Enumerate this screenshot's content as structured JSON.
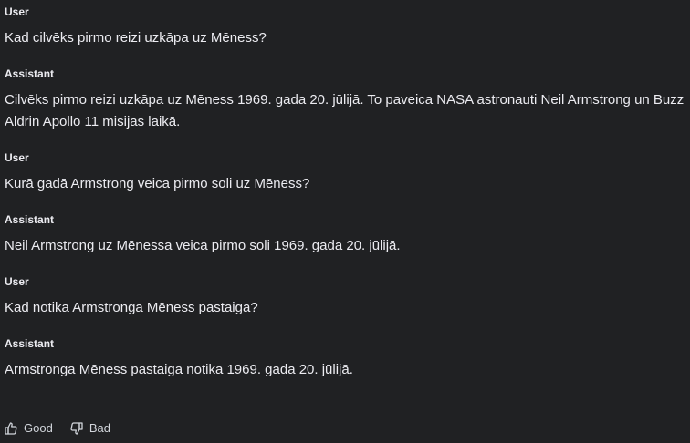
{
  "conversation": [
    {
      "role": "User",
      "text": "Kad cilvēks pirmo reizi uzkāpa uz Mēness?"
    },
    {
      "role": "Assistant",
      "text": "Cilvēks pirmo reizi uzkāpa uz Mēness 1969. gada 20. jūlijā. To paveica NASA astronauti Neil Armstrong un Buzz Aldrin Apollo 11 misijas laikā."
    },
    {
      "role": "User",
      "text": "Kurā gadā Armstrong veica pirmo soli uz Mēness?"
    },
    {
      "role": "Assistant",
      "text": "Neil Armstrong uz Mēnessa veica pirmo soli 1969. gada 20. jūlijā."
    },
    {
      "role": "User",
      "text": "Kad notika Armstronga Mēness pastaiga?"
    },
    {
      "role": "Assistant",
      "text": "Armstronga Mēness pastaiga notika 1969. gada 20. jūlijā."
    }
  ],
  "feedback": {
    "good_label": "Good",
    "bad_label": "Bad",
    "good_icon": "thumbs-up-icon",
    "bad_icon": "thumbs-down-icon"
  },
  "colors": {
    "background": "#202123",
    "text": "#ececf1"
  }
}
